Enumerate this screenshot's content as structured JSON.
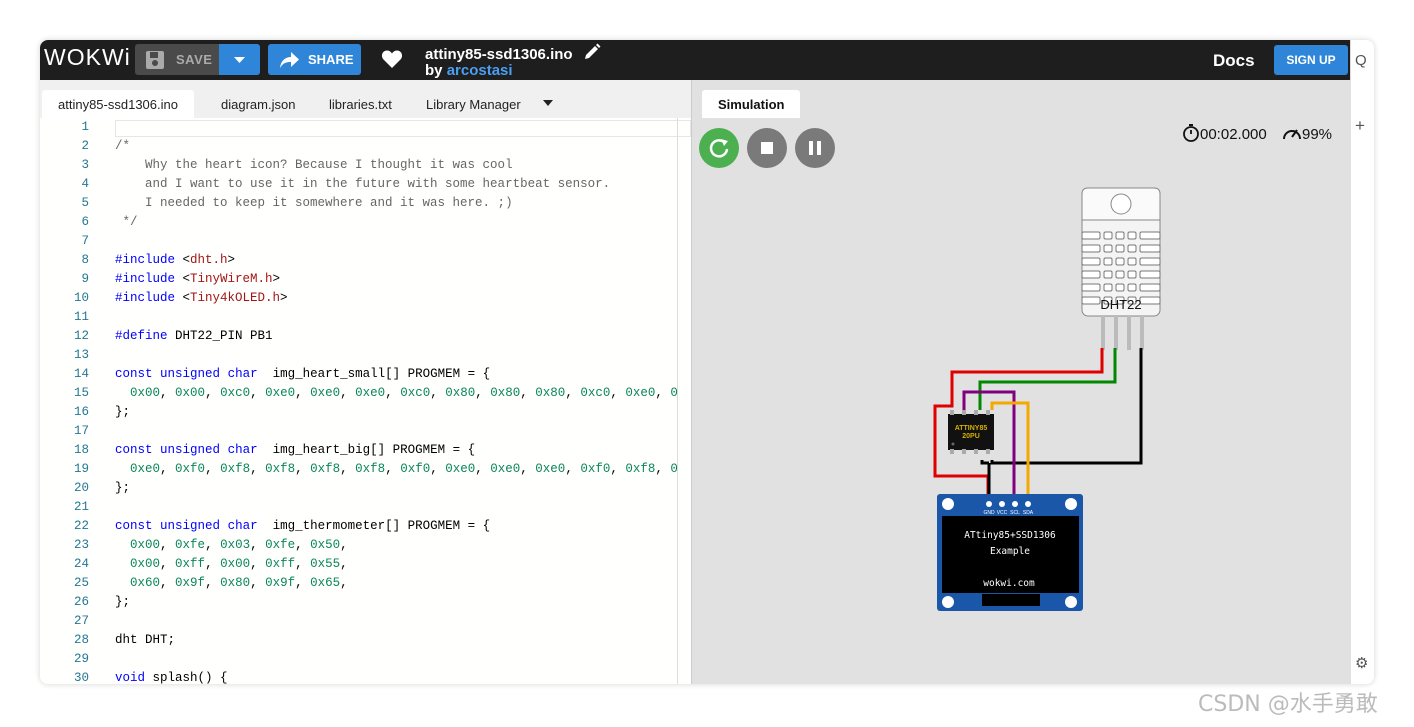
{
  "app": {
    "logo": "WOKWi"
  },
  "toolbar": {
    "save_label": "SAVE",
    "share_label": "SHARE"
  },
  "project": {
    "title": "attiny85-ssd1306.ino",
    "by_prefix": "by",
    "author": "arcostasi"
  },
  "nav": {
    "docs_label": "Docs",
    "signup_label": "SIGN UP"
  },
  "editor": {
    "tabs": [
      {
        "label": "attiny85-ssd1306.ino",
        "active": true
      },
      {
        "label": "diagram.json",
        "active": false
      },
      {
        "label": "libraries.txt",
        "active": false
      },
      {
        "label": "Library Manager",
        "active": false
      }
    ],
    "lines": [
      "",
      "/*",
      "    Why the heart icon? Because I thought it was cool",
      "    and I want to use it in the future with some heartbeat sensor.",
      "    I needed to keep it somewhere and it was here. ;)",
      " */",
      "",
      "#include <dht.h>",
      "#include <TinyWireM.h>",
      "#include <Tiny4kOLED.h>",
      "",
      "#define DHT22_PIN PB1",
      "",
      "const unsigned char  img_heart_small[] PROGMEM = {",
      "  0x00, 0x00, 0xc0, 0xe0, 0xe0, 0xe0, 0xc0, 0x80, 0x80, 0x80, 0xc0, 0xe0, 0",
      "};",
      "",
      "const unsigned char  img_heart_big[] PROGMEM = {",
      "  0xe0, 0xf0, 0xf8, 0xf8, 0xf8, 0xf8, 0xf0, 0xe0, 0xe0, 0xe0, 0xf0, 0xf8, 0",
      "};",
      "",
      "const unsigned char  img_thermometer[] PROGMEM = {",
      "  0x00, 0xfe, 0x03, 0xfe, 0x50,",
      "  0x00, 0xff, 0x00, 0xff, 0x55,",
      "  0x60, 0x9f, 0x80, 0x9f, 0x65,",
      "};",
      "",
      "dht DHT;",
      "",
      "void splash() {"
    ]
  },
  "simulation": {
    "tab_label": "Simulation",
    "timer": "00:02.000",
    "performance": "99%",
    "sensor_label": "DHT22",
    "chip_label_1": "ATTINY85",
    "chip_label_2": "20PU",
    "oled_pins": [
      "GND",
      "VCC",
      "SCL",
      "SDA"
    ],
    "oled_line_1": "ATtiny85+SSD1306",
    "oled_line_2": "Example",
    "oled_line_3": "wokwi.com",
    "wire_colors": {
      "red": "#e00000",
      "green": "#008800",
      "black": "#000000",
      "purple": "#800080",
      "orange": "#f5a800"
    }
  },
  "sidebar_right": {
    "search_glyph": "Q",
    "add_glyph": "+"
  },
  "watermark": "CSDN @水手勇敢"
}
